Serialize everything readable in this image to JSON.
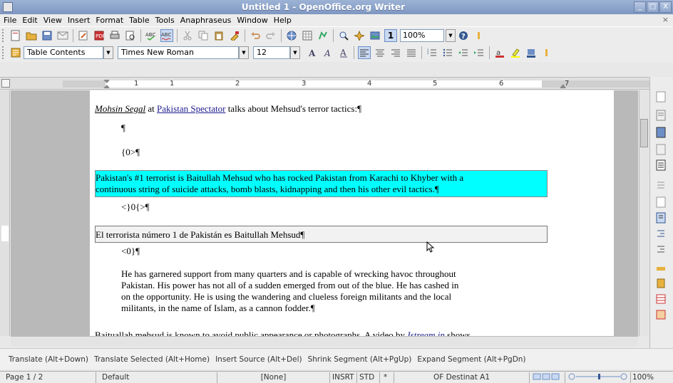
{
  "window": {
    "title": "Untitled 1 - OpenOffice.org Writer",
    "min": "_",
    "max": "□",
    "close": "X"
  },
  "menu": [
    "File",
    "Edit",
    "View",
    "Insert",
    "Format",
    "Table",
    "Tools",
    "Anaphraseus",
    "Window",
    "Help"
  ],
  "menu_close": "×",
  "toolbar": {
    "zoom": "100%",
    "field_shading": "1"
  },
  "format_bar": {
    "style": "Table Contents",
    "font": "Times New Roman",
    "size": "12"
  },
  "ruler_numbers": [
    "1",
    "1",
    "2",
    "3",
    "4",
    "5",
    "6",
    "7"
  ],
  "document": {
    "p1_author": "Mohsin Segal",
    "p1_at": " at ",
    "p1_site": "Pakistan Spectator",
    "p1_rest": " talks about Mehsud's terror tactics:¶",
    "pilcrow": "¶",
    "tag_open": "{0>¶",
    "source_segment_line1": "Pakistan's #1 terrorist is Baitullah Mehsud who has rocked Pakistan from Karachi to Khyber with a",
    "source_segment_line2": "continuous string of suicide attacks, bomb blasts, kidnapping and then his other evil tactics.¶",
    "tag_mid": "<}0{>¶",
    "target_segment": "El terrorista número 1 de Pakistán es Baitullah Mehsud¶",
    "tag_close": "<0}¶",
    "quote_line1": " He has garnered support from many quarters and is capable of wrecking havoc throughout",
    "quote_line2": "Pakistan. His power has not all of a sudden emerged from out of the blue. He has cashed in",
    "quote_line3": "on the opportunity. He is using the wandering and clueless foreign militants and the local",
    "quote_line4": "militants, in the name of Islam, as a cannon fodder.¶",
    "last_text": "Baituallah mehsud is known to avoid public appearance or photographs. A video by ",
    "last_link": "Istream.in",
    "last_tail": " shows"
  },
  "anaphraseus": [
    "Translate (Alt+Down)",
    "Translate Selected (Alt+Home)",
    "Insert Source (Alt+Del)",
    "Shrink Segment (Alt+PgUp)",
    "Expand Segment (Alt+PgDn)"
  ],
  "status": {
    "page": "Page 1 / 2",
    "style": "Default",
    "lang": "[None]",
    "insert": "INSRT",
    "std": "STD",
    "star": "*",
    "cell": "OF Destinat A1",
    "zoom": "100%"
  }
}
